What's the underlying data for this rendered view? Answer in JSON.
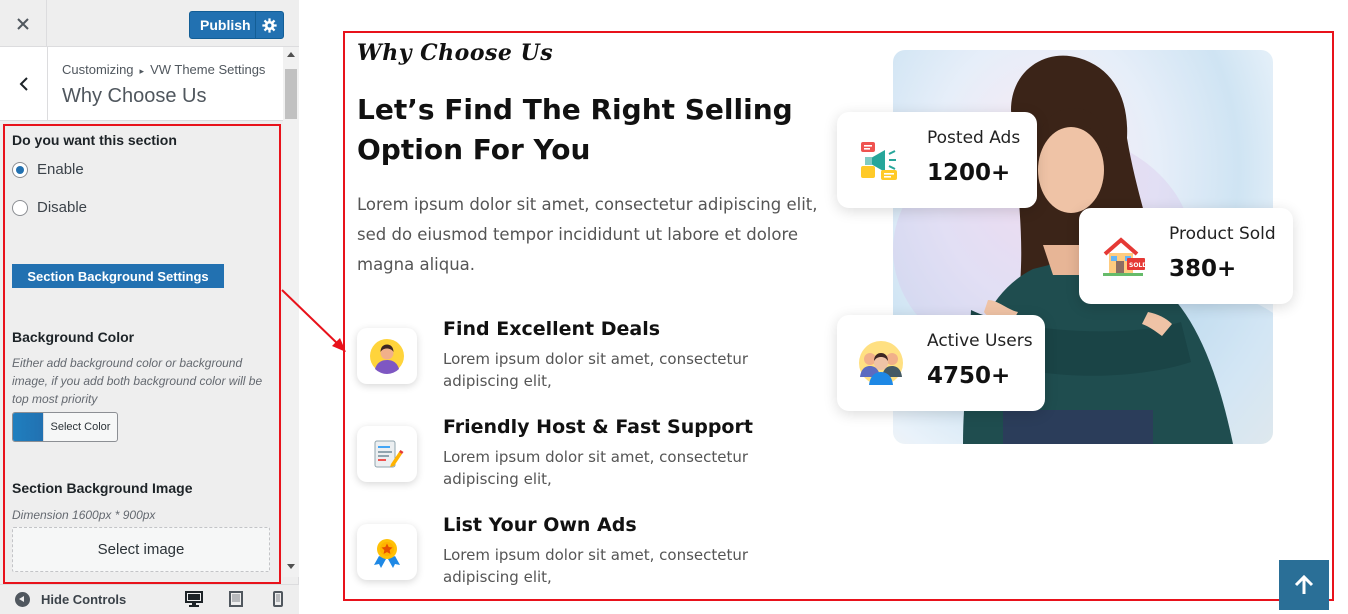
{
  "sidebar": {
    "close_icon": "close-icon",
    "publish_label": "Publish",
    "breadcrumb": {
      "root": "Customizing",
      "parent": "VW Theme Settings"
    },
    "section_title": "Why Choose Us",
    "controls": {
      "enable_question": "Do you want this section",
      "options": [
        {
          "label": "Enable",
          "checked": true
        },
        {
          "label": "Disable",
          "checked": false
        }
      ],
      "bg_settings_label": "Section Background Settings",
      "bg_color_title": "Background Color",
      "bg_color_desc": "Either add background color or background image, if you add both background color will be top most priority",
      "select_color_label": "Select Color",
      "bg_image_title": "Section Background Image",
      "bg_image_dimension": "Dimension 1600px * 900px",
      "select_image_label": "Select image"
    },
    "footer": {
      "hide_controls_label": "Hide Controls"
    },
    "accent_color": "#2271b1",
    "highlight_color": "#e8121b"
  },
  "preview": {
    "eyebrow": "Why Choose Us",
    "headline": "Let’s Find The Right Selling Option For You",
    "lead": "Lorem ipsum dolor sit amet, consectetur adipiscing elit, sed do eiusmod tempor incididunt ut labore et dolore magna aliqua.",
    "features": [
      {
        "title": "Find Excellent Deals",
        "desc": "Lorem ipsum dolor sit amet, consectetur adipiscing elit,",
        "icon": "user-avatar-icon"
      },
      {
        "title": "Friendly Host & Fast Support",
        "desc": "Lorem ipsum dolor sit amet, consectetur adipiscing elit,",
        "icon": "document-pen-icon"
      },
      {
        "title": "List Your Own Ads",
        "desc": "Lorem ipsum dolor sit amet, consectetur adipiscing elit,",
        "icon": "award-medal-icon"
      }
    ],
    "stats": [
      {
        "label": "Posted Ads",
        "value": "1200+",
        "icon": "megaphone-icon"
      },
      {
        "label": "Product Sold",
        "value": "380+",
        "icon": "house-sold-icon"
      },
      {
        "label": "Active Users",
        "value": "4750+",
        "icon": "users-group-icon"
      }
    ],
    "scroll_top_icon": "arrow-up-icon"
  }
}
